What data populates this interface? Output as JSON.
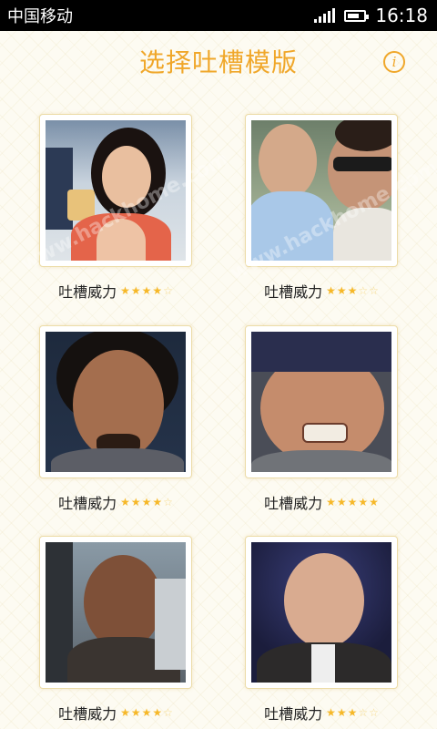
{
  "status_bar": {
    "carrier": "中国移动",
    "time": "16:18"
  },
  "header": {
    "title": "选择吐槽模版",
    "info_icon": "i"
  },
  "templates": [
    {
      "label": "吐槽威力",
      "rating": 4,
      "max": 5
    },
    {
      "label": "吐槽威力",
      "rating": 3,
      "max": 5
    },
    {
      "label": "吐槽威力",
      "rating": 4,
      "max": 5
    },
    {
      "label": "吐槽威力",
      "rating": 5,
      "max": 5
    },
    {
      "label": "吐槽威力",
      "rating": 4,
      "max": 5
    },
    {
      "label": "吐槽威力",
      "rating": 3,
      "max": 5
    }
  ],
  "watermark": "www.hackhome.com",
  "colors": {
    "accent": "#f0a72a",
    "star_on": "#f6b829",
    "star_off": "#f6d98a"
  }
}
